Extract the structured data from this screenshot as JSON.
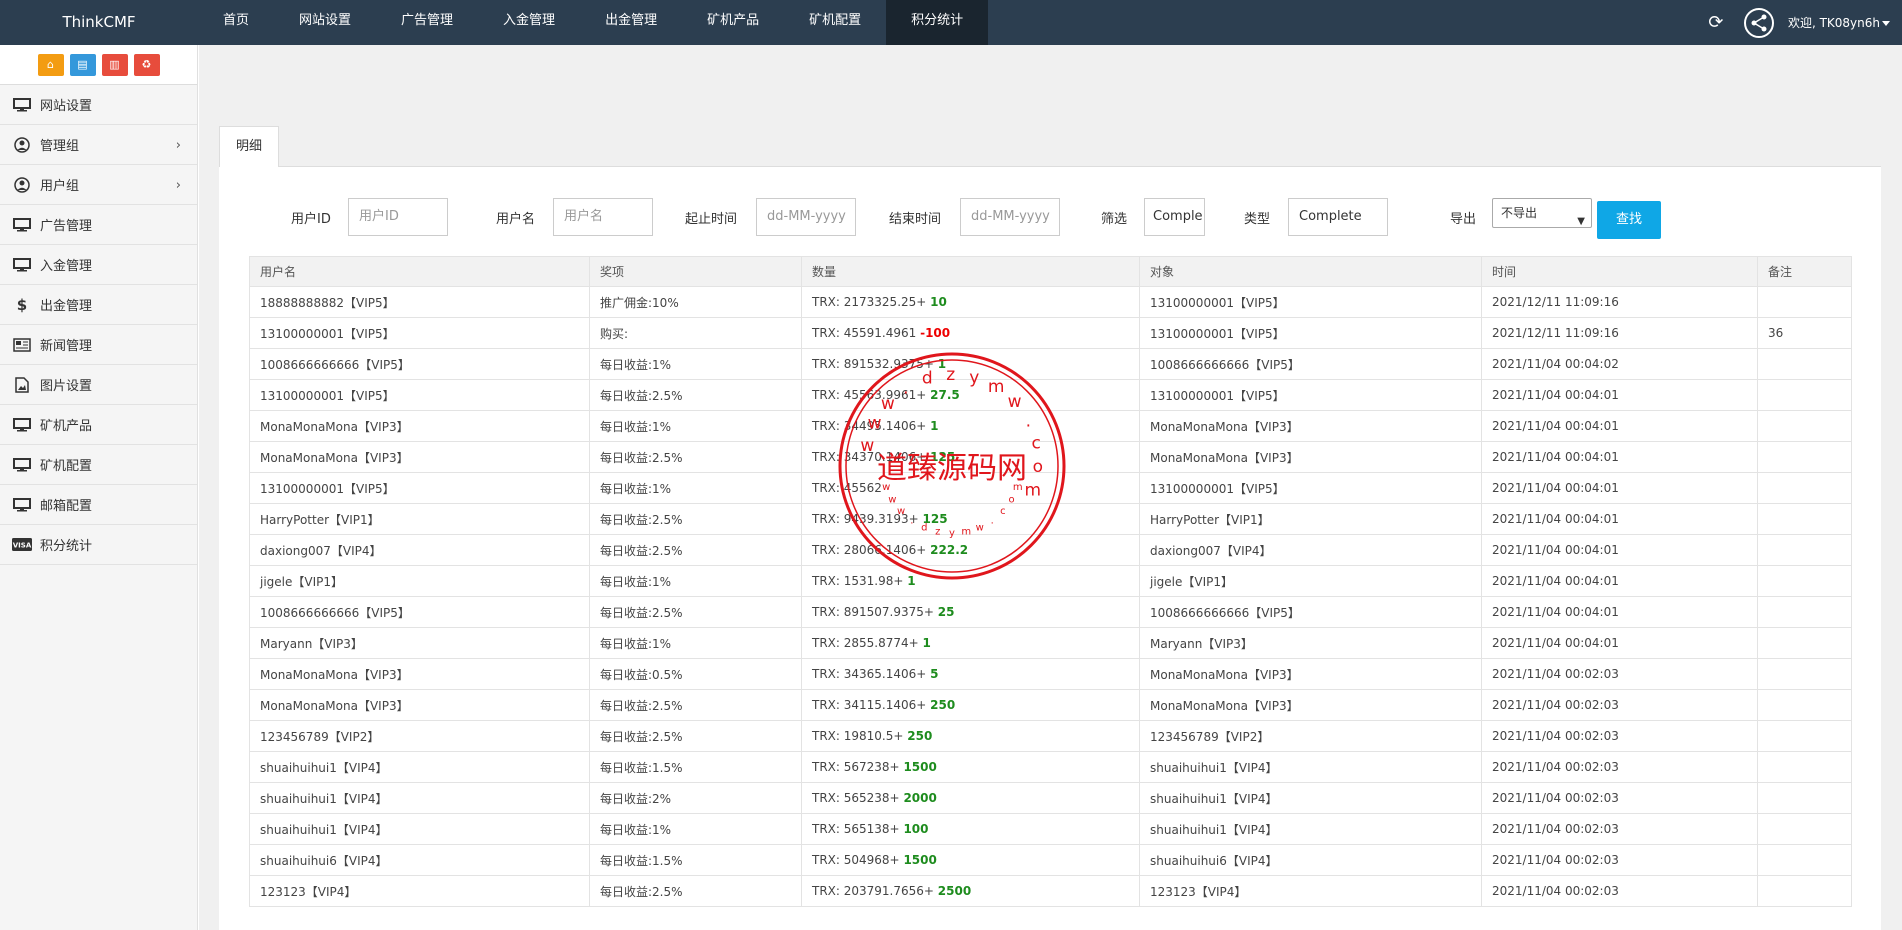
{
  "brand": "ThinkCMF",
  "nav": [
    "首页",
    "网站设置",
    "广告管理",
    "入金管理",
    "出金管理",
    "矿机产品",
    "矿机配置",
    "积分统计"
  ],
  "nav_active": 7,
  "user": {
    "greeting": "欢迎, TK08yn6h"
  },
  "sidebar": {
    "items": [
      {
        "label": "网站设置",
        "icon": "monitor-icon",
        "chevron": false
      },
      {
        "label": "管理组",
        "icon": "user-circle-icon",
        "chevron": true
      },
      {
        "label": "用户组",
        "icon": "user-circle-icon",
        "chevron": true
      },
      {
        "label": "广告管理",
        "icon": "monitor-icon",
        "chevron": false
      },
      {
        "label": "入金管理",
        "icon": "monitor-icon",
        "chevron": false
      },
      {
        "label": "出金管理",
        "icon": "dollar-icon",
        "chevron": false
      },
      {
        "label": "新闻管理",
        "icon": "newspaper-icon",
        "chevron": false
      },
      {
        "label": "图片设置",
        "icon": "image-icon",
        "chevron": false
      },
      {
        "label": "矿机产品",
        "icon": "monitor-icon",
        "chevron": false
      },
      {
        "label": "矿机配置",
        "icon": "monitor-icon",
        "chevron": false
      },
      {
        "label": "邮箱配置",
        "icon": "monitor-icon",
        "chevron": false
      },
      {
        "label": "积分统计",
        "icon": "visa-icon",
        "chevron": false
      }
    ]
  },
  "tab": "明细",
  "filters": {
    "user_id_label": "用户ID",
    "user_id_placeholder": "用户ID",
    "username_label": "用户名",
    "username_placeholder": "用户名",
    "start_label": "起止时间",
    "start_placeholder": "dd-MM-yyyy",
    "end_label": "结束时间",
    "end_placeholder": "dd-MM-yyyy",
    "filter_label": "筛选",
    "filter_value": "Comple",
    "type_label": "类型",
    "type_value": "Complete",
    "export_label": "导出",
    "export_value": "不导出",
    "search_button": "查找"
  },
  "table": {
    "headers": [
      "用户名",
      "奖项",
      "数量",
      "对象",
      "时间",
      "备注"
    ],
    "rows": [
      {
        "user": "18888888882【VIP5】",
        "award": "推广佣金:10%",
        "base": "TRX: 2173325.25+ ",
        "delta": "10",
        "neg": false,
        "target": "13100000001【VIP5】",
        "time": "2021/12/11 11:09:16",
        "note": ""
      },
      {
        "user": "13100000001【VIP5】",
        "award": "购买:",
        "base": "TRX: 45591.4961 ",
        "delta": "-100",
        "neg": true,
        "target": "13100000001【VIP5】",
        "time": "2021/12/11 11:09:16",
        "note": "36"
      },
      {
        "user": "1008666666666【VIP5】",
        "award": "每日收益:1%",
        "base": "TRX: 891532.9375+ ",
        "delta": "1",
        "neg": false,
        "target": "1008666666666【VIP5】",
        "time": "2021/11/04 00:04:02",
        "note": ""
      },
      {
        "user": "13100000001【VIP5】",
        "award": "每日收益:2.5%",
        "base": "TRX: 45563.9961+ ",
        "delta": "27.5",
        "neg": false,
        "target": "13100000001【VIP5】",
        "time": "2021/11/04 00:04:01",
        "note": ""
      },
      {
        "user": "MonaMonaMona【VIP3】",
        "award": "每日收益:1%",
        "base": "TRX: 34495.1406+ ",
        "delta": "1",
        "neg": false,
        "target": "MonaMonaMona【VIP3】",
        "time": "2021/11/04 00:04:01",
        "note": ""
      },
      {
        "user": "MonaMonaMona【VIP3】",
        "award": "每日收益:2.5%",
        "base": "TRX: 34370.1406+ ",
        "delta": "125",
        "neg": false,
        "target": "MonaMonaMona【VIP3】",
        "time": "2021/11/04 00:04:01",
        "note": ""
      },
      {
        "user": "13100000001【VIP5】",
        "award": "每日收益:1%",
        "base": "TRX: 45562",
        "delta": "",
        "neg": false,
        "target": "13100000001【VIP5】",
        "time": "2021/11/04 00:04:01",
        "note": ""
      },
      {
        "user": "HarryPotter【VIP1】",
        "award": "每日收益:2.5%",
        "base": "TRX: 9439.3193+ ",
        "delta": "125",
        "neg": false,
        "target": "HarryPotter【VIP1】",
        "time": "2021/11/04 00:04:01",
        "note": ""
      },
      {
        "user": "daxiong007【VIP4】",
        "award": "每日收益:2.5%",
        "base": "TRX: 28066.1406+ ",
        "delta": "222.2",
        "neg": false,
        "target": "daxiong007【VIP4】",
        "time": "2021/11/04 00:04:01",
        "note": ""
      },
      {
        "user": "jigele【VIP1】",
        "award": "每日收益:1%",
        "base": "TRX: 1531.98+ ",
        "delta": "1",
        "neg": false,
        "target": "jigele【VIP1】",
        "time": "2021/11/04 00:04:01",
        "note": ""
      },
      {
        "user": "1008666666666【VIP5】",
        "award": "每日收益:2.5%",
        "base": "TRX: 891507.9375+ ",
        "delta": "25",
        "neg": false,
        "target": "1008666666666【VIP5】",
        "time": "2021/11/04 00:04:01",
        "note": ""
      },
      {
        "user": "Maryann【VIP3】",
        "award": "每日收益:1%",
        "base": "TRX: 2855.8774+ ",
        "delta": "1",
        "neg": false,
        "target": "Maryann【VIP3】",
        "time": "2021/11/04 00:04:01",
        "note": ""
      },
      {
        "user": "MonaMonaMona【VIP3】",
        "award": "每日收益:0.5%",
        "base": "TRX: 34365.1406+ ",
        "delta": "5",
        "neg": false,
        "target": "MonaMonaMona【VIP3】",
        "time": "2021/11/04 00:02:03",
        "note": ""
      },
      {
        "user": "MonaMonaMona【VIP3】",
        "award": "每日收益:2.5%",
        "base": "TRX: 34115.1406+ ",
        "delta": "250",
        "neg": false,
        "target": "MonaMonaMona【VIP3】",
        "time": "2021/11/04 00:02:03",
        "note": ""
      },
      {
        "user": "123456789【VIP2】",
        "award": "每日收益:2.5%",
        "base": "TRX: 19810.5+ ",
        "delta": "250",
        "neg": false,
        "target": "123456789【VIP2】",
        "time": "2021/11/04 00:02:03",
        "note": ""
      },
      {
        "user": "shuaihuihui1【VIP4】",
        "award": "每日收益:1.5%",
        "base": "TRX: 567238+ ",
        "delta": "1500",
        "neg": false,
        "target": "shuaihuihui1【VIP4】",
        "time": "2021/11/04 00:02:03",
        "note": ""
      },
      {
        "user": "shuaihuihui1【VIP4】",
        "award": "每日收益:2%",
        "base": "TRX: 565238+ ",
        "delta": "2000",
        "neg": false,
        "target": "shuaihuihui1【VIP4】",
        "time": "2021/11/04 00:02:03",
        "note": ""
      },
      {
        "user": "shuaihuihui1【VIP4】",
        "award": "每日收益:1%",
        "base": "TRX: 565138+ ",
        "delta": "100",
        "neg": false,
        "target": "shuaihuihui1【VIP4】",
        "time": "2021/11/04 00:02:03",
        "note": ""
      },
      {
        "user": "shuaihuihui6【VIP4】",
        "award": "每日收益:1.5%",
        "base": "TRX: 504968+ ",
        "delta": "1500",
        "neg": false,
        "target": "shuaihuihui6【VIP4】",
        "time": "2021/11/04 00:02:03",
        "note": ""
      },
      {
        "user": "123123【VIP4】",
        "award": "每日收益:2.5%",
        "base": "TRX: 203791.7656+ ",
        "delta": "2500",
        "neg": false,
        "target": "123123【VIP4】",
        "time": "2021/11/04 00:02:03",
        "note": ""
      }
    ]
  },
  "watermark": {
    "center": "道臻源码网",
    "ring": "www.dzymw.com",
    "color": "#e0161c"
  }
}
